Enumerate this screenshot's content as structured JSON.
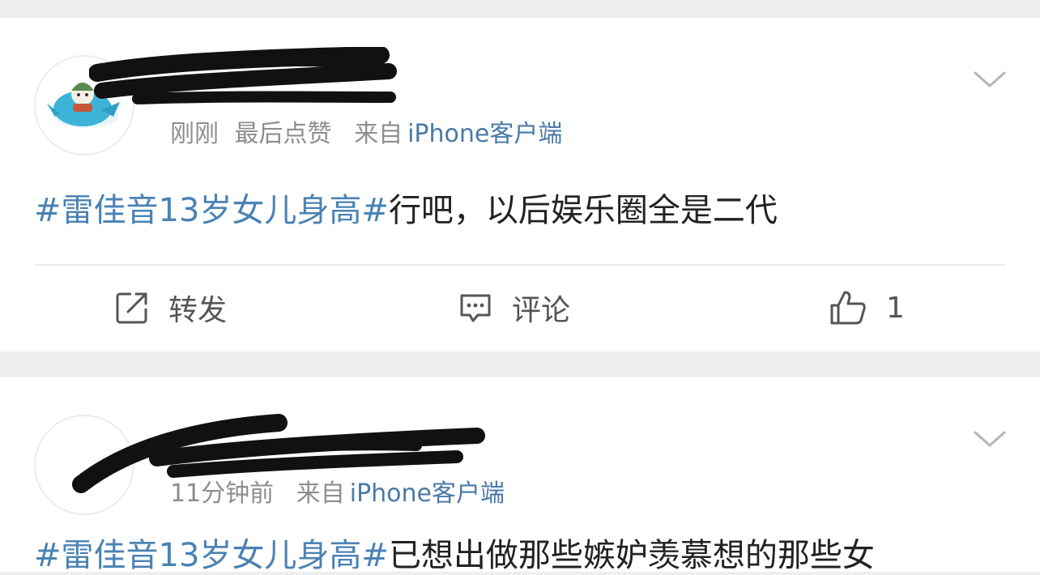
{
  "posts": [
    {
      "time": "刚刚",
      "extra": "最后点赞",
      "source_prefix": "来自",
      "client": "iPhone客户端",
      "topic": "#雷佳音13岁女儿身高#",
      "text": "行吧，以后娱乐圈全是二代",
      "actions": {
        "repost": "转发",
        "comment": "评论",
        "like_count": "1"
      }
    },
    {
      "time": "11分钟前",
      "source_prefix": "来自",
      "client": "iPhone客户端",
      "topic": "#雷佳音13岁女儿身高#",
      "text": "已想出做那些嫉妒羡慕想的那些女"
    }
  ],
  "icons": {
    "chevron": "chevron-down-icon",
    "repost": "share-icon",
    "comment": "comment-icon",
    "like": "thumbs-up-icon"
  },
  "colors": {
    "topic": "#4a82b4",
    "client": "#4a7aa6",
    "meta": "#8e8e8e"
  }
}
